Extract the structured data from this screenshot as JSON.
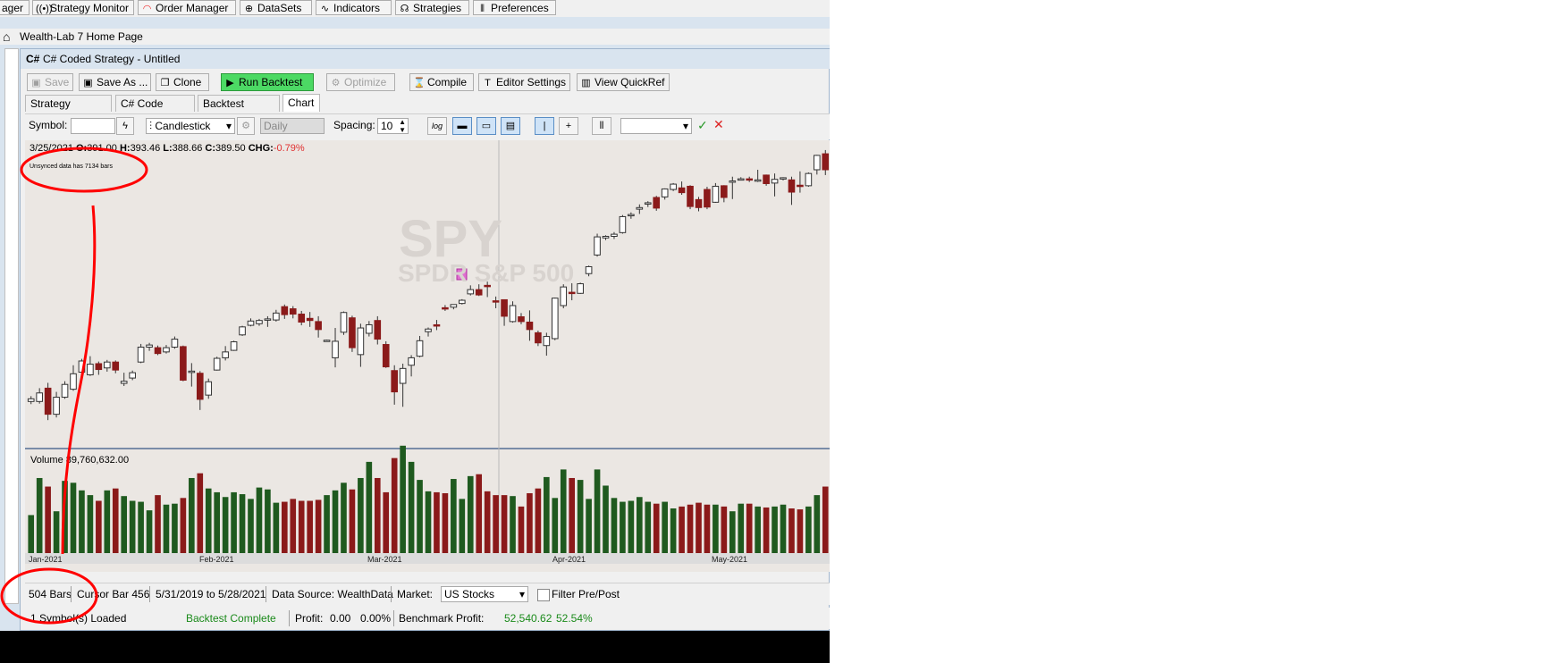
{
  "app_toolbar": {
    "items": [
      {
        "label": "ager",
        "icon": ""
      },
      {
        "label": "Strategy Monitor",
        "icon": "broadcast-icon"
      },
      {
        "label": "Order Manager",
        "icon": "wifi-icon"
      },
      {
        "label": "DataSets",
        "icon": "globe-icon"
      },
      {
        "label": "Indicators",
        "icon": "wave-icon"
      },
      {
        "label": "Strategies",
        "icon": "palette-icon"
      },
      {
        "label": "Preferences",
        "icon": "sliders-icon"
      }
    ]
  },
  "home_tab": {
    "title": "Wealth-Lab 7 Home Page"
  },
  "doc_window": {
    "title": "C# Coded Strategy - Untitled",
    "title_icon": "C#"
  },
  "doc_toolbar": {
    "save": "Save",
    "save_as": "Save As ...",
    "clone": "Clone",
    "run_backtest": "Run Backtest",
    "optimize": "Optimize",
    "compile": "Compile",
    "editor_settings": "Editor Settings",
    "view_quickref": "View QuickRef"
  },
  "tabs": [
    "Strategy Settings",
    "C# Code Editor",
    "Backtest Results",
    "Chart"
  ],
  "chart_toolbar": {
    "symbol_label": "Symbol:",
    "symbol_value": "",
    "chart_style": "Candlestick",
    "scale": "Daily",
    "spacing_label": "Spacing:",
    "spacing_value": "10",
    "log_label": "log"
  },
  "chart_header": {
    "date": "3/25/2021",
    "open_label": "O:",
    "open": "391.00",
    "high_label": "H:",
    "high": "393.46",
    "low_label": "L:",
    "low": "388.66",
    "close_label": "C:",
    "close": "389.50",
    "chg_label": "CHG:",
    "chg": "-0.79%",
    "unsynced": "Unsynced data has 7134 bars"
  },
  "watermark": {
    "symbol": "SPY",
    "name": "SPDR S&P 500"
  },
  "volume_label": "Volume 89,760,632.00",
  "colors": {
    "up_body": "#ffffff",
    "down_body": "#8b1a1a",
    "vol_up": "#1f5a1f",
    "vol_down": "#8b1a1a",
    "chart_bg": "#ebe7e3",
    "run_green": "#4cd964",
    "chg_red": "#e03030",
    "profit_green": "#1a8a1a",
    "annotation_red": "#ff0000"
  },
  "chart_data": {
    "type": "candlestick",
    "x_tick_labels": [
      "Jan-2021",
      "Feb-2021",
      "Mar-2021",
      "Apr-2021",
      "May-2021"
    ],
    "price_range": [
      368,
      420
    ],
    "volume_range": [
      0,
      110
    ],
    "ohlc": [
      [
        376,
        377,
        375.5,
        376.5
      ],
      [
        376,
        378.5,
        375.6,
        377.6
      ],
      [
        378.5,
        379.5,
        372.5,
        373.6
      ],
      [
        373.6,
        377.8,
        373,
        376.8
      ],
      [
        376.8,
        379.8,
        376.5,
        379.2
      ],
      [
        378.3,
        382.8,
        378,
        381.2
      ],
      [
        381.5,
        384,
        381,
        383.6
      ],
      [
        381,
        384.5,
        380.8,
        383
      ],
      [
        383.1,
        383.5,
        381,
        382
      ],
      [
        382.3,
        383.8,
        381.6,
        383.4
      ],
      [
        383.4,
        383.7,
        381.3,
        381.9
      ],
      [
        379.4,
        381.4,
        378.9,
        379.8
      ],
      [
        380.4,
        381.8,
        380,
        381.4
      ],
      [
        383.4,
        386.8,
        383.2,
        386.2
      ],
      [
        386.2,
        387,
        385.5,
        386.6
      ],
      [
        386.1,
        386.5,
        384.7,
        385
      ],
      [
        385.3,
        386.6,
        385,
        386.1
      ],
      [
        386.2,
        388.2,
        385.9,
        387.7
      ],
      [
        386.3,
        386.5,
        379.8,
        380
      ],
      [
        381.6,
        383.2,
        378.8,
        381.7
      ],
      [
        381.3,
        381.7,
        374.4,
        376.4
      ],
      [
        377.2,
        380.3,
        376.5,
        379.7
      ],
      [
        381.9,
        384.4,
        381.8,
        384.1
      ],
      [
        384.2,
        386.4,
        383.7,
        385.3
      ],
      [
        385.6,
        387.4,
        385.5,
        387.2
      ],
      [
        388.5,
        390.2,
        388.3,
        390
      ],
      [
        390.3,
        391.6,
        390.1,
        391.1
      ],
      [
        390.6,
        391.5,
        390.2,
        391.2
      ],
      [
        391.4,
        392,
        390,
        391.5
      ],
      [
        391.3,
        393.2,
        391,
        392.6
      ],
      [
        393.8,
        394.2,
        391.5,
        392.3
      ],
      [
        393.4,
        393.9,
        391.6,
        392.4
      ],
      [
        392.4,
        393,
        390.3,
        390.9
      ],
      [
        391.6,
        392.8,
        390,
        391.2
      ],
      [
        391,
        392,
        388,
        389.5
      ],
      [
        387.4,
        387.6,
        387.4,
        387.5
      ],
      [
        384.2,
        389.8,
        382.4,
        387.3
      ],
      [
        389,
        392.9,
        388.5,
        392.7
      ],
      [
        391.7,
        392.1,
        385.3,
        386.1
      ],
      [
        384.8,
        390.6,
        382.5,
        389.8
      ],
      [
        388.8,
        391.1,
        388.2,
        390.4
      ],
      [
        391.2,
        392,
        386.7,
        387.7
      ],
      [
        386.7,
        387.3,
        382.3,
        382.5
      ],
      [
        381.8,
        382.8,
        375.4,
        377.8
      ],
      [
        379.4,
        383.1,
        375,
        382.2
      ],
      [
        382.8,
        384.7,
        380.7,
        384.2
      ],
      [
        384.5,
        388.3,
        384.3,
        387.4
      ],
      [
        389.1,
        389.9,
        388.2,
        389.6
      ],
      [
        390.4,
        391.3,
        389.4,
        390.2
      ],
      [
        393.6,
        394.1,
        393,
        393.4
      ],
      [
        393.7,
        394.2,
        393.3,
        394.2
      ],
      [
        394.4,
        395.2,
        394.2,
        395
      ],
      [
        396.2,
        397.8,
        395.9,
        397
      ],
      [
        397,
        398,
        395.8,
        396
      ],
      [
        397.8,
        398.5,
        395.6,
        397.6
      ],
      [
        394.9,
        395.7,
        393.5,
        394.7
      ],
      [
        395.1,
        395.1,
        390.2,
        392
      ],
      [
        391,
        394.8,
        390.8,
        394
      ],
      [
        391.9,
        392.6,
        390.5,
        391
      ],
      [
        390.9,
        393.1,
        387.4,
        389.5
      ],
      [
        388.9,
        389.3,
        386.4,
        387
      ],
      [
        386.5,
        388.9,
        384.6,
        388.2
      ],
      [
        387.8,
        395.5,
        387.5,
        395.4
      ],
      [
        394,
        398,
        393.5,
        397.5
      ],
      [
        396.5,
        398.2,
        395,
        396.3
      ],
      [
        396.3,
        398.3,
        396.2,
        398.1
      ],
      [
        400,
        401.5,
        399.5,
        401.3
      ],
      [
        403.5,
        407.5,
        403.2,
        406.9
      ],
      [
        406.7,
        407.2,
        406.3,
        407
      ],
      [
        407,
        407.8,
        406.5,
        407.4
      ],
      [
        407.7,
        411,
        407.5,
        410.7
      ],
      [
        411,
        411.5,
        410.3,
        411.1
      ],
      [
        412.1,
        413,
        411.2,
        412.4
      ],
      [
        413.2,
        413.6,
        412.5,
        413.3
      ],
      [
        414.3,
        414.6,
        411.8,
        412.3
      ],
      [
        414.4,
        416,
        413.9,
        415.9
      ],
      [
        415.8,
        417,
        415.5,
        416.8
      ],
      [
        416.1,
        417.3,
        414.8,
        415.2
      ],
      [
        416.4,
        416.6,
        412.1,
        412.6
      ],
      [
        413.9,
        414.4,
        411.7,
        412.4
      ],
      [
        415.8,
        416.3,
        412.1,
        412.5
      ],
      [
        413.4,
        417,
        413.3,
        416.4
      ],
      [
        416.5,
        416.6,
        413.4,
        414.3
      ],
      [
        417.4,
        418.2,
        414,
        417.4
      ],
      [
        417.8,
        418.1,
        417.6,
        417.8
      ],
      [
        417.8,
        418.2,
        417.2,
        417.6
      ],
      [
        417.4,
        419.5,
        417.2,
        417.6
      ],
      [
        418.5,
        418.6,
        416.5,
        416.9
      ],
      [
        417,
        418.8,
        414.5,
        417.7
      ],
      [
        417.9,
        418.1,
        417.5,
        418
      ],
      [
        417.6,
        418.2,
        412.9,
        415.3
      ],
      [
        416.6,
        419.2,
        415.2,
        416.5
      ],
      [
        416.5,
        419,
        416.3,
        418.8
      ],
      [
        419.5,
        422.3,
        418.6,
        422.2
      ],
      [
        422.5,
        423.2,
        418.5,
        419.5
      ]
    ],
    "volume": [
      40,
      79,
      70,
      44,
      76,
      74,
      66,
      61,
      55,
      66,
      68,
      60,
      55,
      54,
      45,
      61,
      51,
      52,
      58,
      79,
      84,
      68,
      64,
      59,
      64,
      62,
      57,
      69,
      67,
      53,
      54,
      57,
      55,
      55,
      56,
      61,
      66,
      74,
      67,
      79,
      96,
      79,
      64,
      100,
      113,
      96,
      77,
      65,
      64,
      63,
      78,
      57,
      81,
      83,
      65,
      61,
      61,
      60,
      49,
      63,
      68,
      80,
      58,
      88,
      79,
      77,
      57,
      88,
      71,
      58,
      54,
      55,
      59,
      54,
      52,
      54,
      47,
      49,
      51,
      53,
      51,
      51,
      49,
      44,
      52,
      52,
      49,
      48,
      49,
      51,
      47,
      46,
      49,
      61,
      70
    ]
  },
  "status_bar": {
    "bars": "504 Bars",
    "cursor": "Cursor Bar 456",
    "range": "5/31/2019 to 5/28/2021",
    "data_source": "Data Source: WealthData",
    "market_label": "Market:",
    "market_value": "US Stocks",
    "filter": "Filter Pre/Post"
  },
  "bottom_status": {
    "loaded": "1 Symbol(s) Loaded",
    "backtest": "Backtest Complete",
    "profit_label": "Profit:",
    "profit": "0.00",
    "profit_pct": "0.00%",
    "bench_label": "Benchmark Profit:",
    "bench": "52,540.62",
    "bench_pct": "52.54%"
  }
}
